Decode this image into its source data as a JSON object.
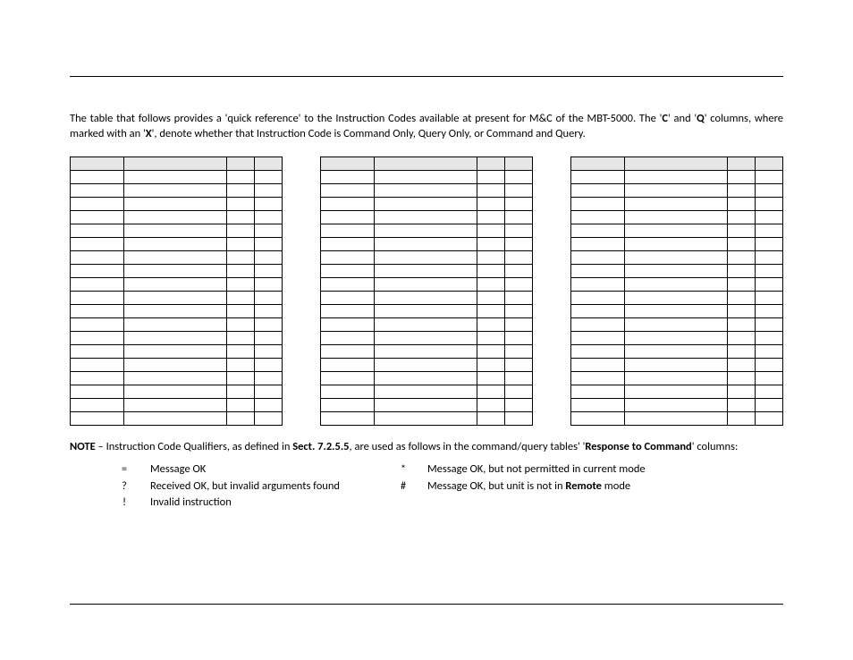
{
  "intro": {
    "part1": "The table that follows provides a 'quick reference' to the Instruction Codes available at present for M&C of the MBT-5000. The '",
    "bold1": "C",
    "part2": "' and '",
    "bold2": "Q",
    "part3": "' columns, where marked with an '",
    "bold3": "X",
    "part4": "', denote whether that Instruction Code is Command Only, Query Only, or Command and Query."
  },
  "note": {
    "bold_note": "NOTE",
    "part1": " – Instruction Code Qualifiers, as defined in ",
    "bold_sect": "Sect. 7.2.5.5",
    "part2": ", are used as follows in the command/query tables' '",
    "bold_resp": "Response to Command",
    "part3": "' columns:"
  },
  "qualifiers_left": [
    {
      "sym": "=",
      "text": "Message OK"
    },
    {
      "sym": "?",
      "text": "Received OK, but invalid arguments found"
    },
    {
      "sym": "!",
      "text": "Invalid instruction"
    }
  ],
  "qualifiers_right": [
    {
      "sym": "*",
      "text_pre": "Message OK, but not permitted in current mode",
      "bold": "",
      "text_post": ""
    },
    {
      "sym": "#",
      "text_pre": "Message OK, but unit is not in ",
      "bold": "Remote",
      "text_post": " mode"
    }
  ]
}
